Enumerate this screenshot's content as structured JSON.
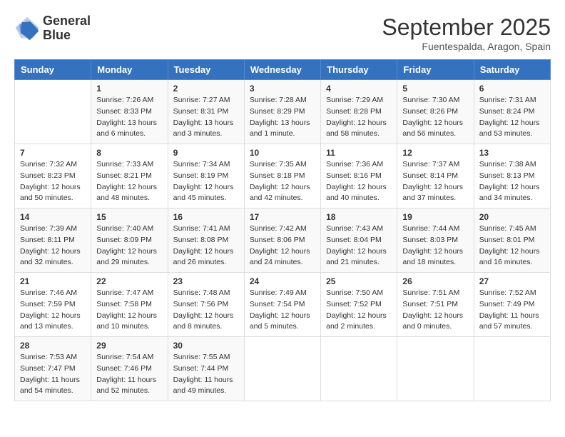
{
  "logo": {
    "line1": "General",
    "line2": "Blue"
  },
  "title": "September 2025",
  "subtitle": "Fuentespalda, Aragon, Spain",
  "days_of_week": [
    "Sunday",
    "Monday",
    "Tuesday",
    "Wednesday",
    "Thursday",
    "Friday",
    "Saturday"
  ],
  "weeks": [
    [
      {
        "day": "",
        "sunrise": "",
        "sunset": "",
        "daylight": ""
      },
      {
        "day": "1",
        "sunrise": "Sunrise: 7:26 AM",
        "sunset": "Sunset: 8:33 PM",
        "daylight": "Daylight: 13 hours and 6 minutes."
      },
      {
        "day": "2",
        "sunrise": "Sunrise: 7:27 AM",
        "sunset": "Sunset: 8:31 PM",
        "daylight": "Daylight: 13 hours and 3 minutes."
      },
      {
        "day": "3",
        "sunrise": "Sunrise: 7:28 AM",
        "sunset": "Sunset: 8:29 PM",
        "daylight": "Daylight: 13 hours and 1 minute."
      },
      {
        "day": "4",
        "sunrise": "Sunrise: 7:29 AM",
        "sunset": "Sunset: 8:28 PM",
        "daylight": "Daylight: 12 hours and 58 minutes."
      },
      {
        "day": "5",
        "sunrise": "Sunrise: 7:30 AM",
        "sunset": "Sunset: 8:26 PM",
        "daylight": "Daylight: 12 hours and 56 minutes."
      },
      {
        "day": "6",
        "sunrise": "Sunrise: 7:31 AM",
        "sunset": "Sunset: 8:24 PM",
        "daylight": "Daylight: 12 hours and 53 minutes."
      }
    ],
    [
      {
        "day": "7",
        "sunrise": "Sunrise: 7:32 AM",
        "sunset": "Sunset: 8:23 PM",
        "daylight": "Daylight: 12 hours and 50 minutes."
      },
      {
        "day": "8",
        "sunrise": "Sunrise: 7:33 AM",
        "sunset": "Sunset: 8:21 PM",
        "daylight": "Daylight: 12 hours and 48 minutes."
      },
      {
        "day": "9",
        "sunrise": "Sunrise: 7:34 AM",
        "sunset": "Sunset: 8:19 PM",
        "daylight": "Daylight: 12 hours and 45 minutes."
      },
      {
        "day": "10",
        "sunrise": "Sunrise: 7:35 AM",
        "sunset": "Sunset: 8:18 PM",
        "daylight": "Daylight: 12 hours and 42 minutes."
      },
      {
        "day": "11",
        "sunrise": "Sunrise: 7:36 AM",
        "sunset": "Sunset: 8:16 PM",
        "daylight": "Daylight: 12 hours and 40 minutes."
      },
      {
        "day": "12",
        "sunrise": "Sunrise: 7:37 AM",
        "sunset": "Sunset: 8:14 PM",
        "daylight": "Daylight: 12 hours and 37 minutes."
      },
      {
        "day": "13",
        "sunrise": "Sunrise: 7:38 AM",
        "sunset": "Sunset: 8:13 PM",
        "daylight": "Daylight: 12 hours and 34 minutes."
      }
    ],
    [
      {
        "day": "14",
        "sunrise": "Sunrise: 7:39 AM",
        "sunset": "Sunset: 8:11 PM",
        "daylight": "Daylight: 12 hours and 32 minutes."
      },
      {
        "day": "15",
        "sunrise": "Sunrise: 7:40 AM",
        "sunset": "Sunset: 8:09 PM",
        "daylight": "Daylight: 12 hours and 29 minutes."
      },
      {
        "day": "16",
        "sunrise": "Sunrise: 7:41 AM",
        "sunset": "Sunset: 8:08 PM",
        "daylight": "Daylight: 12 hours and 26 minutes."
      },
      {
        "day": "17",
        "sunrise": "Sunrise: 7:42 AM",
        "sunset": "Sunset: 8:06 PM",
        "daylight": "Daylight: 12 hours and 24 minutes."
      },
      {
        "day": "18",
        "sunrise": "Sunrise: 7:43 AM",
        "sunset": "Sunset: 8:04 PM",
        "daylight": "Daylight: 12 hours and 21 minutes."
      },
      {
        "day": "19",
        "sunrise": "Sunrise: 7:44 AM",
        "sunset": "Sunset: 8:03 PM",
        "daylight": "Daylight: 12 hours and 18 minutes."
      },
      {
        "day": "20",
        "sunrise": "Sunrise: 7:45 AM",
        "sunset": "Sunset: 8:01 PM",
        "daylight": "Daylight: 12 hours and 16 minutes."
      }
    ],
    [
      {
        "day": "21",
        "sunrise": "Sunrise: 7:46 AM",
        "sunset": "Sunset: 7:59 PM",
        "daylight": "Daylight: 12 hours and 13 minutes."
      },
      {
        "day": "22",
        "sunrise": "Sunrise: 7:47 AM",
        "sunset": "Sunset: 7:58 PM",
        "daylight": "Daylight: 12 hours and 10 minutes."
      },
      {
        "day": "23",
        "sunrise": "Sunrise: 7:48 AM",
        "sunset": "Sunset: 7:56 PM",
        "daylight": "Daylight: 12 hours and 8 minutes."
      },
      {
        "day": "24",
        "sunrise": "Sunrise: 7:49 AM",
        "sunset": "Sunset: 7:54 PM",
        "daylight": "Daylight: 12 hours and 5 minutes."
      },
      {
        "day": "25",
        "sunrise": "Sunrise: 7:50 AM",
        "sunset": "Sunset: 7:52 PM",
        "daylight": "Daylight: 12 hours and 2 minutes."
      },
      {
        "day": "26",
        "sunrise": "Sunrise: 7:51 AM",
        "sunset": "Sunset: 7:51 PM",
        "daylight": "Daylight: 12 hours and 0 minutes."
      },
      {
        "day": "27",
        "sunrise": "Sunrise: 7:52 AM",
        "sunset": "Sunset: 7:49 PM",
        "daylight": "Daylight: 11 hours and 57 minutes."
      }
    ],
    [
      {
        "day": "28",
        "sunrise": "Sunrise: 7:53 AM",
        "sunset": "Sunset: 7:47 PM",
        "daylight": "Daylight: 11 hours and 54 minutes."
      },
      {
        "day": "29",
        "sunrise": "Sunrise: 7:54 AM",
        "sunset": "Sunset: 7:46 PM",
        "daylight": "Daylight: 11 hours and 52 minutes."
      },
      {
        "day": "30",
        "sunrise": "Sunrise: 7:55 AM",
        "sunset": "Sunset: 7:44 PM",
        "daylight": "Daylight: 11 hours and 49 minutes."
      },
      {
        "day": "",
        "sunrise": "",
        "sunset": "",
        "daylight": ""
      },
      {
        "day": "",
        "sunrise": "",
        "sunset": "",
        "daylight": ""
      },
      {
        "day": "",
        "sunrise": "",
        "sunset": "",
        "daylight": ""
      },
      {
        "day": "",
        "sunrise": "",
        "sunset": "",
        "daylight": ""
      }
    ]
  ]
}
